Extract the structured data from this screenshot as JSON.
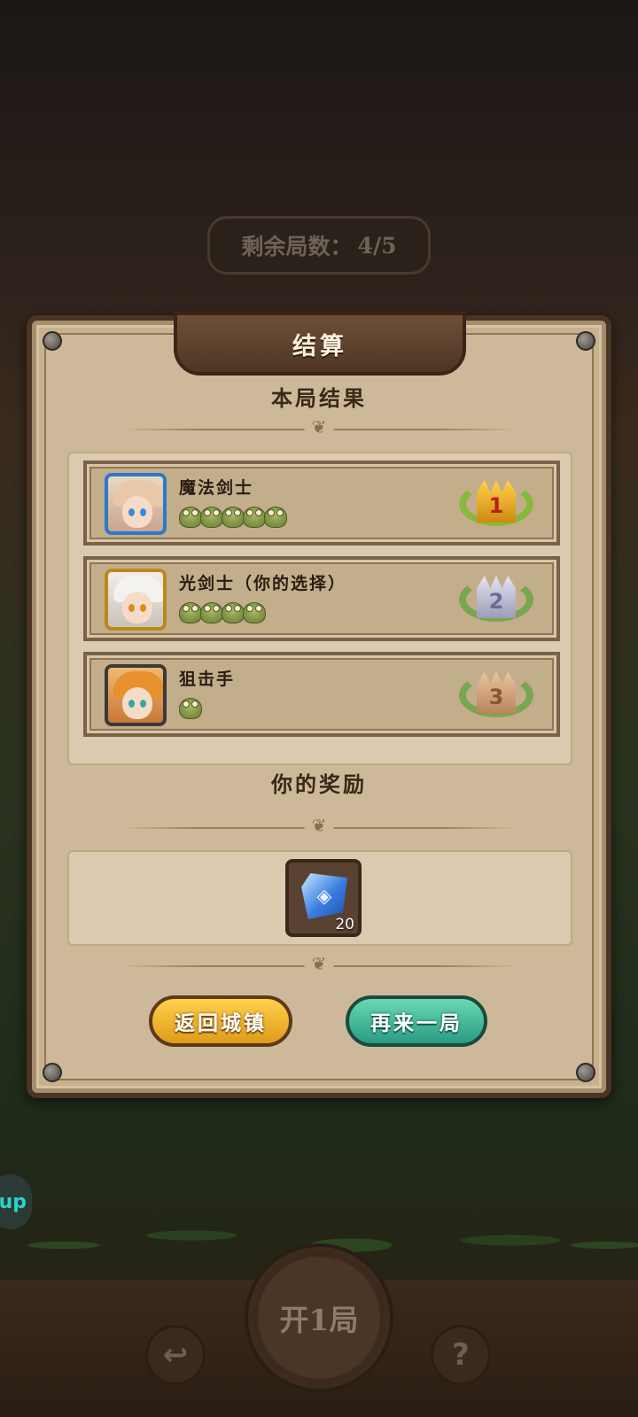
{
  "header": {
    "round_label": "剩余局数：",
    "round_value": "4/5"
  },
  "dialog": {
    "title": "结算",
    "results_title": "本局结果",
    "rewards_title": "你的奖励",
    "results": [
      {
        "name": "魔法剑士",
        "frog_count": 5,
        "rank": 1
      },
      {
        "name": "光剑士（你的选择）",
        "frog_count": 4,
        "rank": 2
      },
      {
        "name": "狙击手",
        "frog_count": 1,
        "rank": 3
      }
    ],
    "reward": {
      "icon": "blue-gem-icon",
      "count": "20"
    },
    "buttons": {
      "back_to_town": "返回城镇",
      "play_again": "再来一局"
    }
  },
  "bottom": {
    "start_label": "开1局",
    "side_tab_label": "up",
    "undo_icon": "undo-icon",
    "help_icon": "help-icon",
    "help_glyph": "?"
  },
  "colors": {
    "panel": "#c7b18f",
    "title_tab": "#5a3f2b",
    "btn_town": "#f3b62e",
    "btn_again": "#3fbd9c",
    "avatar_border_blue": "#2a7ac6",
    "avatar_border_gold": "#b88a1e"
  }
}
